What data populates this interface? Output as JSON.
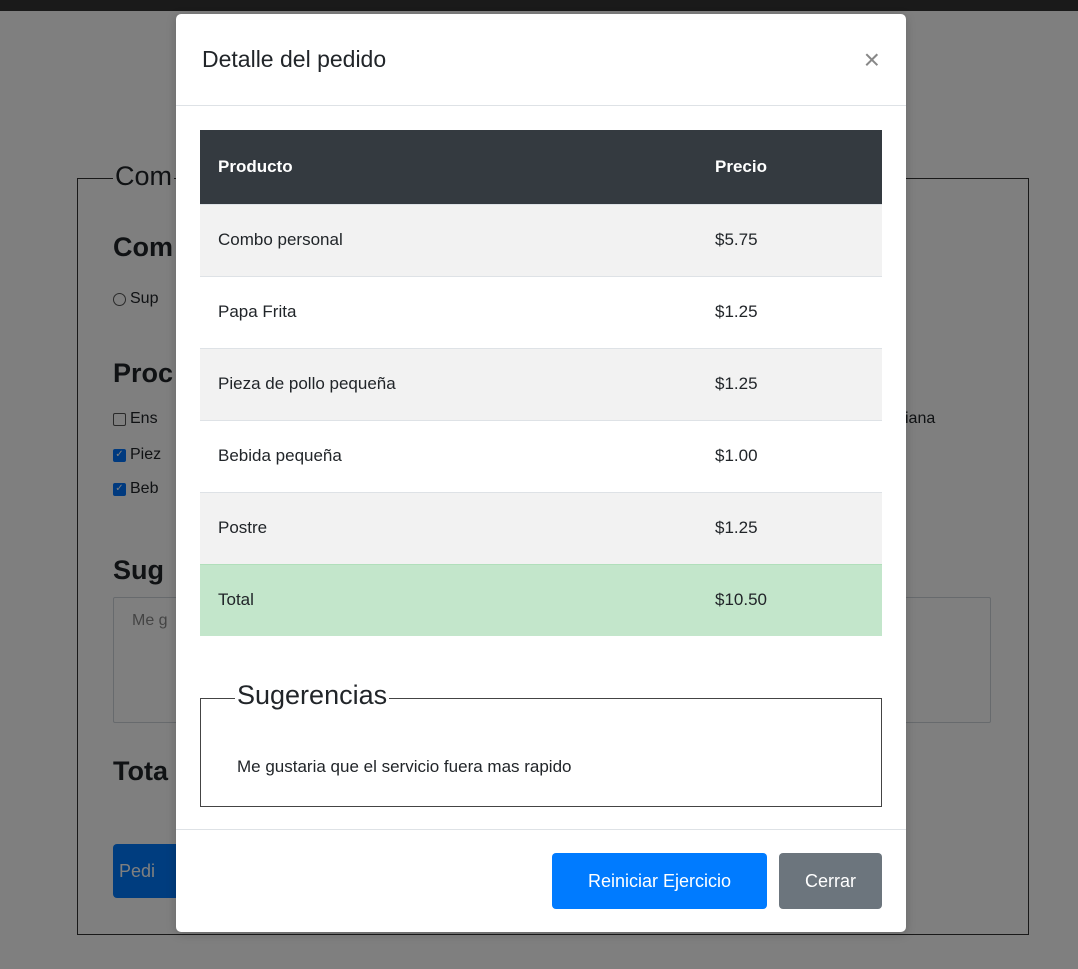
{
  "background": {
    "legend": "Com",
    "combo_heading": "Com",
    "radio_label": "Sup",
    "products_heading": "Proc",
    "checkboxes": [
      {
        "label": "Ens",
        "checked": false
      },
      {
        "label": "Piez",
        "checked": true
      },
      {
        "label": "Beb",
        "checked": true
      }
    ],
    "side_text": "iana",
    "suggestions_heading": "Sug",
    "textarea_placeholder": "Me g",
    "total_heading": "Tota",
    "submit_label": "Pedi"
  },
  "modal": {
    "title": "Detalle del pedido",
    "close_glyph": "×",
    "table": {
      "headers": [
        "Producto",
        "Precio"
      ],
      "rows": [
        {
          "product": "Combo personal",
          "price": "$5.75"
        },
        {
          "product": "Papa Frita",
          "price": "$1.25"
        },
        {
          "product": "Pieza de pollo pequeña",
          "price": "$1.25"
        },
        {
          "product": "Bebida pequeña",
          "price": "$1.00"
        },
        {
          "product": "Postre",
          "price": "$1.25"
        }
      ],
      "total": {
        "label": "Total",
        "price": "$10.50"
      }
    },
    "suggestions": {
      "legend": "Sugerencias",
      "text": "Me gustaria que el servicio fuera mas rapido"
    },
    "footer": {
      "reset_label": "Reiniciar Ejercicio",
      "close_label": "Cerrar"
    }
  },
  "colors": {
    "primary": "#007bff",
    "secondary": "#6c757d",
    "table_header": "#343a40",
    "total_row": "#c3e6cb"
  }
}
